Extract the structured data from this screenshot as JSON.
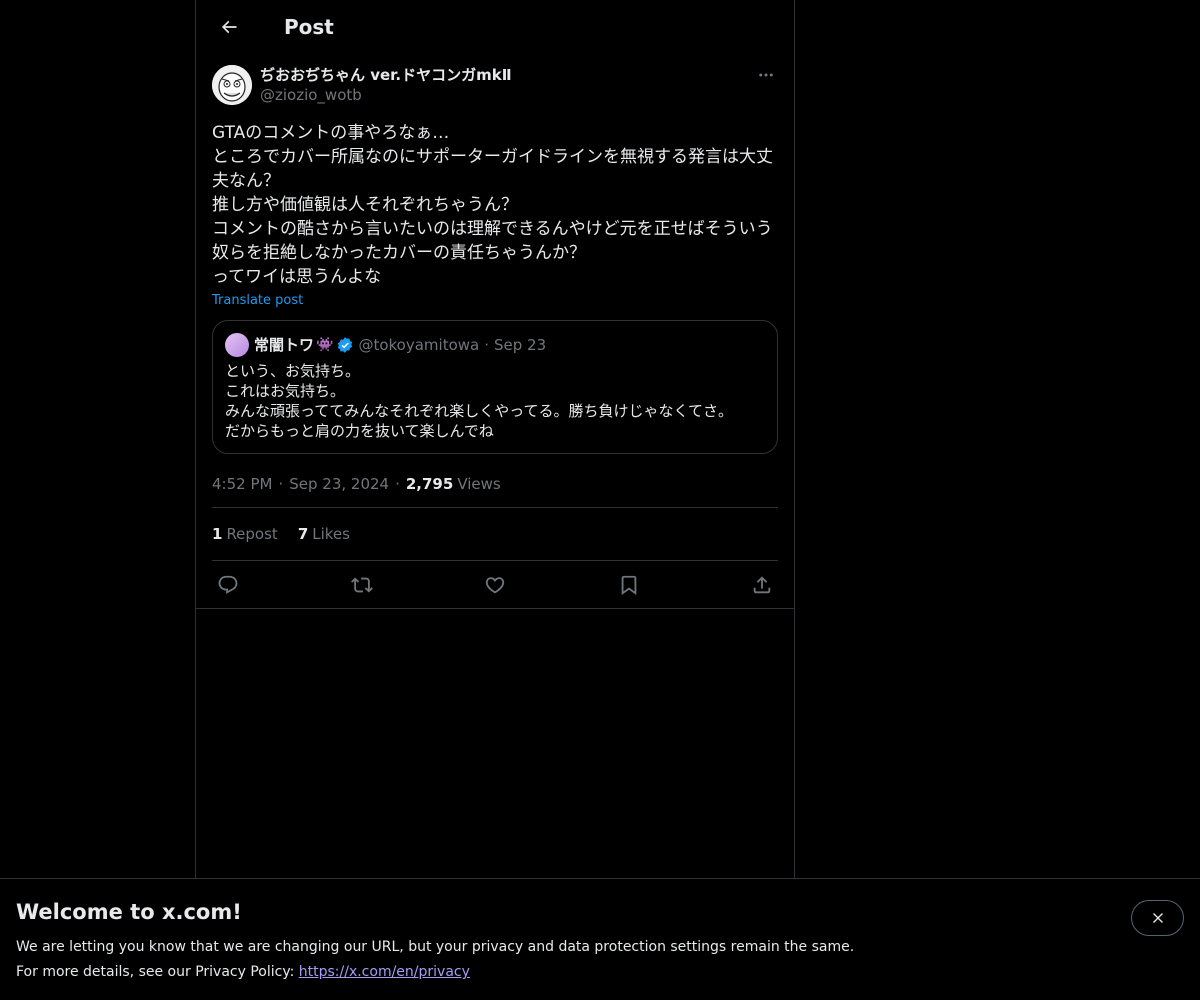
{
  "header": {
    "title": "Post"
  },
  "post": {
    "display_name": "ぢおおぢちゃん ver.ドヤコンガmkⅡ",
    "handle": "@ziozio_wotb",
    "text": "GTAのコメントの事やろなぁ…\nところでカバー所属なのにサポーターガイドラインを無視する発言は大丈\n夫なん？\n推し方や価値観は人それぞれちゃうん？\nコメントの酷さから言いたいのは理解できるんやけど元を正せばそういう\n奴らを拒絶しなかったカバーの責任ちゃうんか？\nってワイは思うんよな",
    "translate_label": "Translate post",
    "quote": {
      "name": "常闇トワ",
      "emoji": "👾",
      "handle": "@tokoyamitowa",
      "dot": "·",
      "date": "Sep 23",
      "text": "という、お気持ち。\nこれはお気持ち。\nみんな頑張っててみんなそれぞれ楽しくやってる。勝ち負けじゃなくてさ。\nだからもっと肩の力を抜いて楽しんでね"
    },
    "time": "4:52 PM",
    "date": "Sep 23, 2024",
    "sep": "·",
    "views_count": "2,795",
    "views_label": "Views",
    "reposts_count": "1",
    "reposts_label": "Repost",
    "likes_count": "7",
    "likes_label": "Likes"
  },
  "icons": [
    "back-arrow-icon",
    "more-icon",
    "verified-icon",
    "reply-icon",
    "repost-icon",
    "like-icon",
    "bookmark-icon",
    "share-icon",
    "close-icon"
  ],
  "colors": {
    "background": "#000000",
    "text": "#e7e9ea",
    "secondary": "#71767b",
    "accent": "#1d9bf0",
    "border": "#2f3336",
    "link": "#a59cf5"
  },
  "banner": {
    "title": "Welcome to x.com!",
    "line1": "We are letting you know that we are changing our URL, but your privacy and data protection settings remain the same.",
    "line2_prefix": "For more details, see our Privacy Policy: ",
    "line2_link": "https://x.com/en/privacy"
  }
}
